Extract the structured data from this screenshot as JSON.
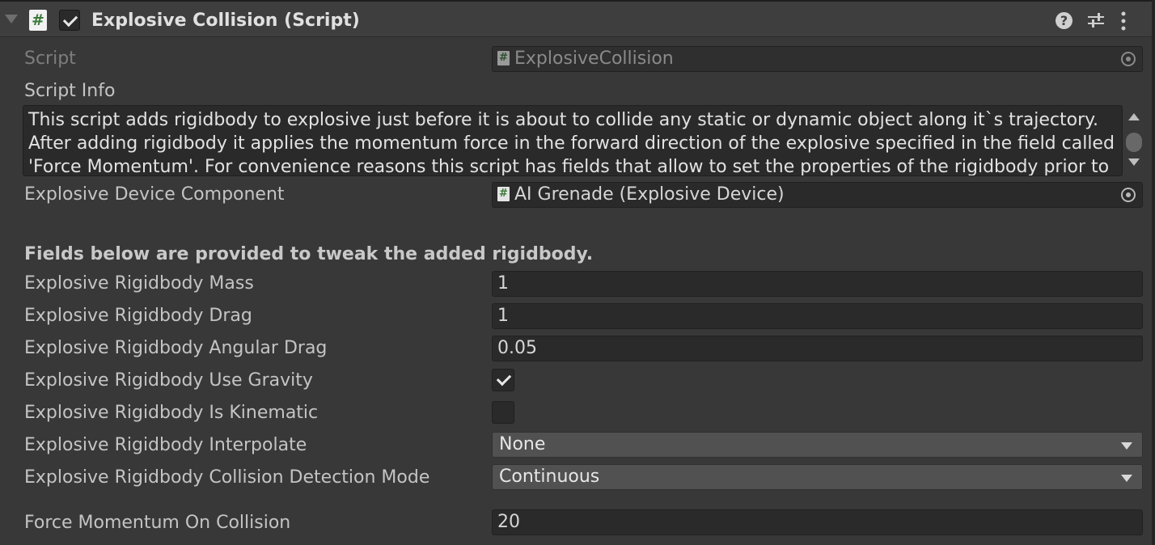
{
  "component": {
    "title": "Explosive Collision (Script)",
    "icon": "script-hash-icon",
    "enabled": true,
    "script_icon_glyph": "#",
    "help_glyph": "?"
  },
  "fields": {
    "script": {
      "label": "Script",
      "value": "ExplosiveCollision"
    },
    "script_info": {
      "label": "Script Info",
      "lines": [
        "This script adds rigidbody to explosive just before it is about to collide any static or dynamic object along it`s trajectory.",
        "After adding rigidbody it applies the momentum force in the forward direction of the explosive specified in the field called",
        "'Force Momentum'. For convenience reasons this script has fields that allow to set the properties of the rigidbody prior to"
      ]
    },
    "explosive_device_component": {
      "label": "Explosive Device Component",
      "value": "AI Grenade (Explosive Device)"
    },
    "section_note": "Fields below are provided to tweak the added rigidbody.",
    "mass": {
      "label": "Explosive Rigidbody Mass",
      "value": "1"
    },
    "drag": {
      "label": "Explosive Rigidbody Drag",
      "value": "1"
    },
    "angular_drag": {
      "label": "Explosive Rigidbody Angular Drag",
      "value": "0.05"
    },
    "use_gravity": {
      "label": "Explosive Rigidbody Use Gravity",
      "checked": true
    },
    "is_kinematic": {
      "label": "Explosive Rigidbody Is Kinematic",
      "checked": false
    },
    "interpolate": {
      "label": "Explosive Rigidbody Interpolate",
      "value": "None"
    },
    "collision_detection": {
      "label": "Explosive Rigidbody Collision Detection Mode",
      "value": "Continuous"
    },
    "force_momentum": {
      "label": "Force Momentum On Collision",
      "value": "20"
    }
  },
  "colors": {
    "background": "#383838",
    "header": "#3e3e3e",
    "field": "#2a2a2a",
    "dropdown": "#515151",
    "script_icon_green": "#3a7a3a"
  }
}
